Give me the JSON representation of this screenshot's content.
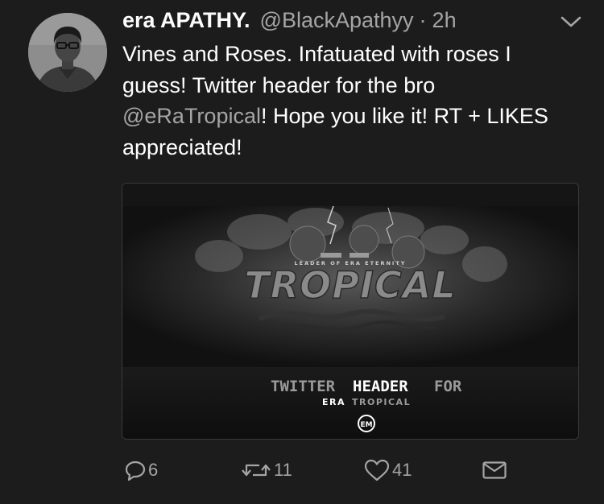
{
  "tweet": {
    "author": {
      "display_name": "era APATHY.",
      "handle": "@BlackApathyy",
      "separator": "·",
      "time": "2h"
    },
    "text": {
      "line_before_mention": "Vines and Roses. Infatuated with roses I guess! Twitter header for the bro",
      "mention": "@eRaTropical",
      "line_after_mention": "! Hope you like it! RT + LIKES appreciated!"
    },
    "media": {
      "tagline": "LEADER OF ERA ETERNITY",
      "title": "TROPICAL",
      "caption_word1": "TWITTER",
      "caption_word2": "HEADER",
      "caption_word3": "FOR",
      "subcaption_a": "ERA",
      "subcaption_b": "TROPICAL",
      "logo_text": "EM"
    },
    "actions": {
      "replies": "6",
      "retweets": "11",
      "likes": "41"
    },
    "icons": {
      "reply": "reply-icon",
      "retweet": "retweet-icon",
      "like": "heart-icon",
      "message": "envelope-icon",
      "menu": "chevron-down-icon"
    },
    "colors": {
      "background": "#1c1c1c",
      "primary_text": "#ffffff",
      "secondary_text": "#a5a5a5"
    }
  }
}
